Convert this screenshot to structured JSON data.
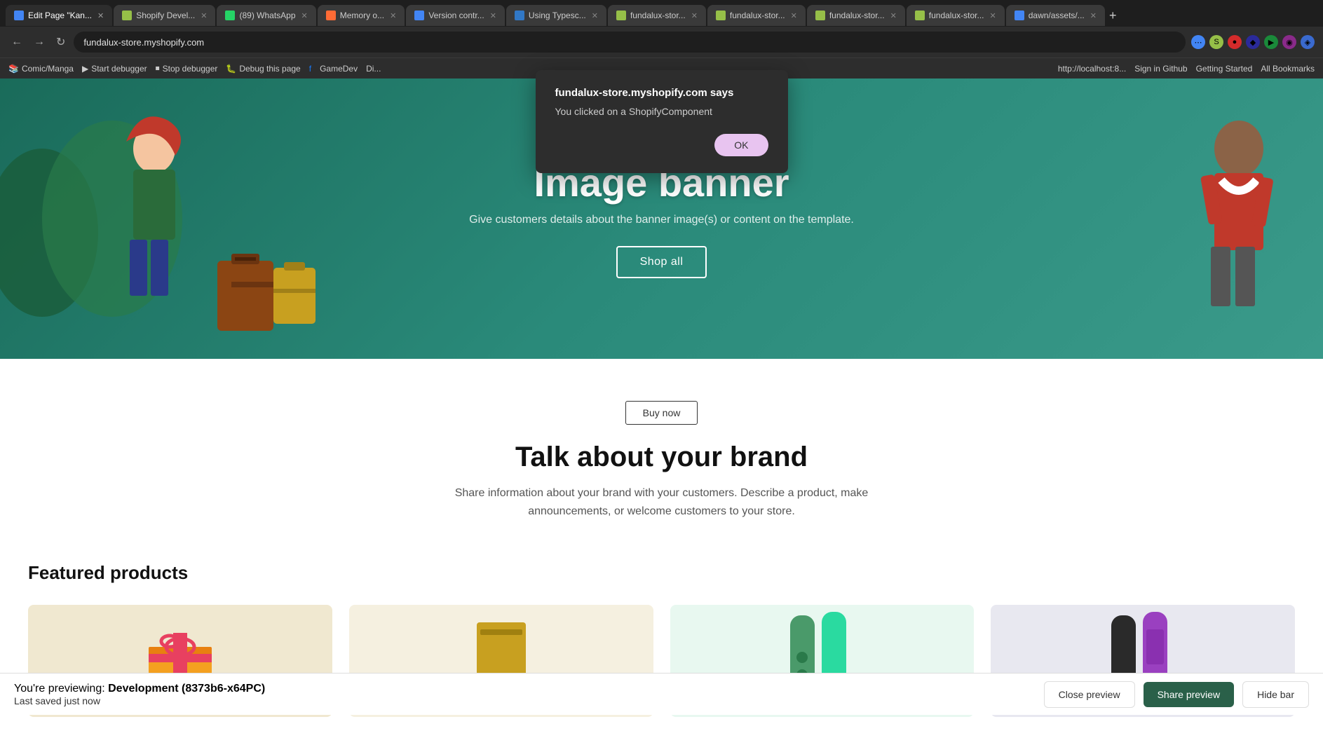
{
  "browser": {
    "url": "fundalux-store.myshopify.com",
    "tabs": [
      {
        "id": "tab-1",
        "label": "Edit Page \"Kan...",
        "favicon_color": "#4285f4",
        "active": true
      },
      {
        "id": "tab-2",
        "label": "Shopify Devel...",
        "favicon_color": "#96bf48",
        "active": false
      },
      {
        "id": "tab-3",
        "label": "(89) WhatsApp",
        "favicon_color": "#25d366",
        "active": false
      },
      {
        "id": "tab-4",
        "label": "Memory o...",
        "favicon_color": "#ff6b35",
        "active": false
      },
      {
        "id": "tab-5",
        "label": "Version contr...",
        "favicon_color": "#4285f4",
        "active": false
      },
      {
        "id": "tab-6",
        "label": "Using Typesc...",
        "favicon_color": "#3178c6",
        "active": false
      },
      {
        "id": "tab-7",
        "label": "fundalux-stor...",
        "favicon_color": "#96bf48",
        "active": false
      },
      {
        "id": "tab-8",
        "label": "fundalux-stor...",
        "favicon_color": "#96bf48",
        "active": false
      },
      {
        "id": "tab-9",
        "label": "fundalux-stor...",
        "favicon_color": "#96bf48",
        "active": false
      },
      {
        "id": "tab-10",
        "label": "fundalux-stor...",
        "favicon_color": "#96bf48",
        "active": false
      },
      {
        "id": "tab-11",
        "label": "dawn/assets/...",
        "favicon_color": "#4285f4",
        "active": false
      }
    ],
    "bookmarks": [
      "Comic/Manga",
      "Start debugger",
      "Stop debugger",
      "Debug this page",
      "GameDev",
      "Di...",
      "http://localhost:8...",
      "Sign in Github",
      "Getting Started"
    ]
  },
  "dialog": {
    "visible": true,
    "site": "fundalux-store.myshopify.com says",
    "message": "You clicked on a ShopifyComponent",
    "ok_label": "OK"
  },
  "hero": {
    "title": "Image banner",
    "subtitle": "Give customers details about the banner image(s) or content on the template.",
    "button_label": "Shop all"
  },
  "brand": {
    "buy_button_label": "Buy now",
    "title": "Talk about your brand",
    "description": "Share information about your brand with your customers. Describe a product, make announcements, or welcome customers to your store."
  },
  "featured": {
    "title": "Featured products"
  },
  "bottom_bar": {
    "preview_label": "You're previewing:",
    "preview_name": "Development (8373b6-x64PC)",
    "last_saved": "Last saved just now",
    "close_label": "Close preview",
    "share_label": "Share preview",
    "hide_label": "Hide bar"
  }
}
